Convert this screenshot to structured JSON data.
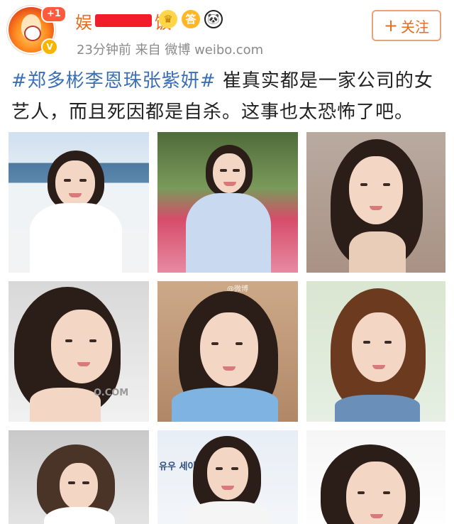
{
  "post": {
    "plus_badge": "+1",
    "verified_badge": "V",
    "username_visible_start": "娱",
    "username_visible_end": "饭",
    "badges": [
      "crown-icon",
      "medal-icon",
      "panda-icon"
    ],
    "badge_glyphs": {
      "crown": "♛",
      "medal": "答",
      "panda": "🐼"
    },
    "meta_text": "23分钟前  来自 微博 weibo.com",
    "follow_plus": "+",
    "follow_label": "关注",
    "hashtag": "#郑多彬李恩珠张紫妍#",
    "body_text": " 崔真实都是一家公司的女艺人，而且死因都是自杀。这事也太恐怖了吧。"
  },
  "photos": {
    "watermark": "@微博",
    "p8_board": "유우 세이름   롯데",
    "p4_stamp": "O.COM"
  },
  "colors": {
    "accent_orange": "#e86b1e",
    "hashtag_blue": "#3a6fb5",
    "redact_red": "#f21d2a"
  }
}
